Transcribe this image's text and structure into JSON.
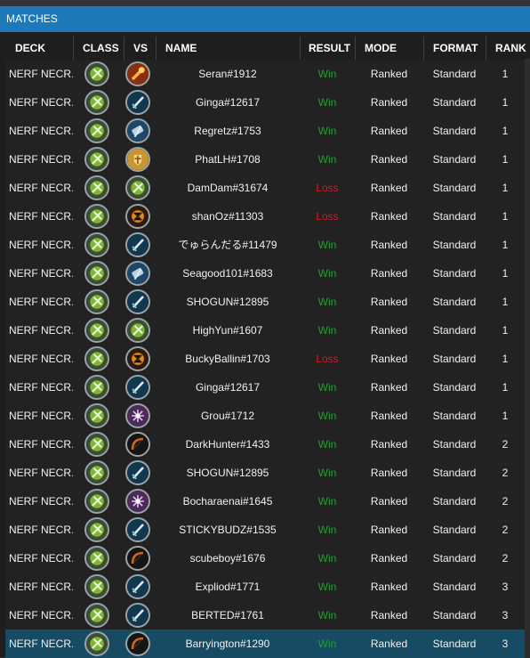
{
  "panel": {
    "title": "MATCHES"
  },
  "columns": {
    "deck": "DECK",
    "class": "CLASS",
    "vs": "VS",
    "name": "NAME",
    "result": "RESULT",
    "mode": "MODE",
    "format": "FORMAT",
    "rank": "RANK"
  },
  "colors": {
    "accent": "#1d7ab8",
    "win": "#1ea32d",
    "loss": "#e81123",
    "selected_row": "#164b63"
  },
  "rows": [
    {
      "deck": "NERF NECR...",
      "class_icon": "death-knight-icon",
      "vs_icon": "fire-mage-icon",
      "name": "Seran#1912",
      "result": "Win",
      "mode": "Ranked",
      "format": "Standard",
      "rank": "1"
    },
    {
      "deck": "NERF NECR...",
      "class_icon": "death-knight-icon",
      "vs_icon": "sword-icon",
      "name": "Ginga#12617",
      "result": "Win",
      "mode": "Ranked",
      "format": "Standard",
      "rank": "1"
    },
    {
      "deck": "NERF NECR...",
      "class_icon": "death-knight-icon",
      "vs_icon": "hammer-icon",
      "name": "Regretz#1753",
      "result": "Win",
      "mode": "Ranked",
      "format": "Standard",
      "rank": "1"
    },
    {
      "deck": "NERF NECR...",
      "class_icon": "death-knight-icon",
      "vs_icon": "paladin-icon",
      "name": "PhatLH#1708",
      "result": "Win",
      "mode": "Ranked",
      "format": "Standard",
      "rank": "1"
    },
    {
      "deck": "NERF NECR...",
      "class_icon": "death-knight-icon",
      "vs_icon": "death-knight-icon",
      "name": "DamDam#31674",
      "result": "Loss",
      "mode": "Ranked",
      "format": "Standard",
      "rank": "1"
    },
    {
      "deck": "NERF NECR...",
      "class_icon": "death-knight-icon",
      "vs_icon": "warlock-icon",
      "name": "shanOz#11303",
      "result": "Loss",
      "mode": "Ranked",
      "format": "Standard",
      "rank": "1"
    },
    {
      "deck": "NERF NECR...",
      "class_icon": "death-knight-icon",
      "vs_icon": "sword-icon",
      "name": "でゅらんだる#11479",
      "result": "Win",
      "mode": "Ranked",
      "format": "Standard",
      "rank": "1"
    },
    {
      "deck": "NERF NECR...",
      "class_icon": "death-knight-icon",
      "vs_icon": "hammer-icon",
      "name": "Seagood101#1683",
      "result": "Win",
      "mode": "Ranked",
      "format": "Standard",
      "rank": "1"
    },
    {
      "deck": "NERF NECR...",
      "class_icon": "death-knight-icon",
      "vs_icon": "sword-icon",
      "name": "SHOGUN#12895",
      "result": "Win",
      "mode": "Ranked",
      "format": "Standard",
      "rank": "1"
    },
    {
      "deck": "NERF NECR...",
      "class_icon": "death-knight-icon",
      "vs_icon": "death-knight-icon",
      "name": "HighYun#1607",
      "result": "Win",
      "mode": "Ranked",
      "format": "Standard",
      "rank": "1"
    },
    {
      "deck": "NERF NECR...",
      "class_icon": "death-knight-icon",
      "vs_icon": "warlock-icon",
      "name": "BuckyBallin#1703",
      "result": "Loss",
      "mode": "Ranked",
      "format": "Standard",
      "rank": "1"
    },
    {
      "deck": "NERF NECR...",
      "class_icon": "death-knight-icon",
      "vs_icon": "sword-icon",
      "name": "Ginga#12617",
      "result": "Win",
      "mode": "Ranked",
      "format": "Standard",
      "rank": "1"
    },
    {
      "deck": "NERF NECR...",
      "class_icon": "death-knight-icon",
      "vs_icon": "priest-icon",
      "name": "Grou#1712",
      "result": "Win",
      "mode": "Ranked",
      "format": "Standard",
      "rank": "1"
    },
    {
      "deck": "NERF NECR...",
      "class_icon": "death-knight-icon",
      "vs_icon": "bow-icon",
      "name": "DarkHunter#1433",
      "result": "Win",
      "mode": "Ranked",
      "format": "Standard",
      "rank": "2"
    },
    {
      "deck": "NERF NECR...",
      "class_icon": "death-knight-icon",
      "vs_icon": "sword-icon",
      "name": "SHOGUN#12895",
      "result": "Win",
      "mode": "Ranked",
      "format": "Standard",
      "rank": "2"
    },
    {
      "deck": "NERF NECR...",
      "class_icon": "death-knight-icon",
      "vs_icon": "priest-icon",
      "name": "Bocharaenai#1645",
      "result": "Win",
      "mode": "Ranked",
      "format": "Standard",
      "rank": "2"
    },
    {
      "deck": "NERF NECR...",
      "class_icon": "death-knight-icon",
      "vs_icon": "sword-icon",
      "name": "STICKYBUDZ#1535",
      "result": "Win",
      "mode": "Ranked",
      "format": "Standard",
      "rank": "2"
    },
    {
      "deck": "NERF NECR...",
      "class_icon": "death-knight-icon",
      "vs_icon": "bow-icon",
      "name": "scubeboy#1676",
      "result": "Win",
      "mode": "Ranked",
      "format": "Standard",
      "rank": "2"
    },
    {
      "deck": "NERF NECR...",
      "class_icon": "death-knight-icon",
      "vs_icon": "sword-icon",
      "name": "Expliod#1771",
      "result": "Win",
      "mode": "Ranked",
      "format": "Standard",
      "rank": "3"
    },
    {
      "deck": "NERF NECR...",
      "class_icon": "death-knight-icon",
      "vs_icon": "sword-icon",
      "name": "BERTED#1761",
      "result": "Win",
      "mode": "Ranked",
      "format": "Standard",
      "rank": "3"
    },
    {
      "deck": "NERF NECR...",
      "class_icon": "death-knight-icon",
      "vs_icon": "bow-icon",
      "name": "Barryington#1290",
      "result": "Win",
      "mode": "Ranked",
      "format": "Standard",
      "rank": "3",
      "selected": true
    }
  ]
}
